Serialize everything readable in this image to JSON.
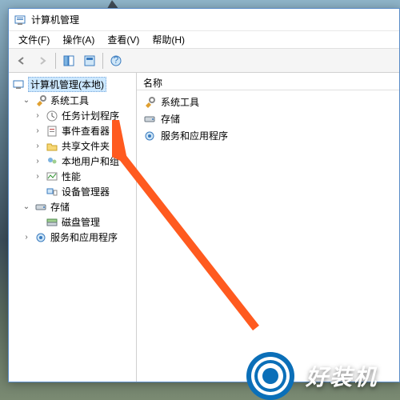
{
  "window": {
    "title": "计算机管理"
  },
  "menu": {
    "file": "文件(F)",
    "action": "操作(A)",
    "view": "查看(V)",
    "help": "帮助(H)"
  },
  "tree": {
    "root": "计算机管理(本地)",
    "system_tools": "系统工具",
    "task_scheduler": "任务计划程序",
    "event_viewer": "事件查看器",
    "shared_folders": "共享文件夹",
    "local_users": "本地用户和组",
    "performance": "性能",
    "device_manager": "设备管理器",
    "storage": "存储",
    "disk_mgmt": "磁盘管理",
    "services_apps": "服务和应用程序"
  },
  "content": {
    "header": "名称",
    "items": {
      "system_tools": "系统工具",
      "storage": "存储",
      "services_apps": "服务和应用程序"
    }
  },
  "watermark": "好装机",
  "icons": {
    "twister_open": "⌄",
    "twister_closed": "›"
  }
}
